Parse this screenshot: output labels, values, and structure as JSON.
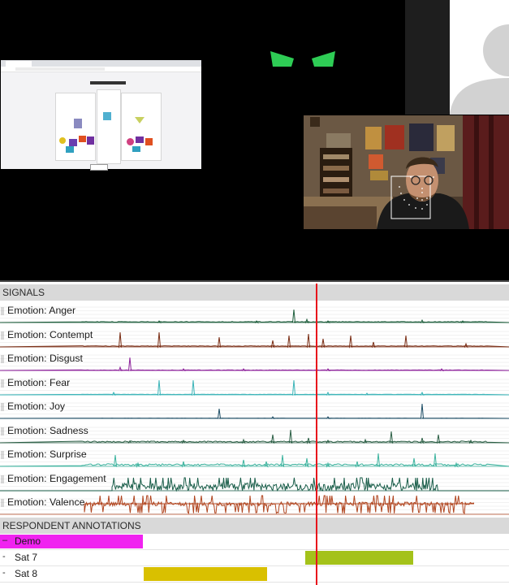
{
  "video": {
    "background": "#000000",
    "eyes_color": "#2ecc55",
    "avatar_icon": "person-silhouette-icon",
    "webcam_subject": "webcam-participant-feed",
    "screen_share": "shared-browser-window"
  },
  "signals_section": {
    "title": "SIGNALS",
    "signals": [
      {
        "label": "Emotion: Anger",
        "color": "#1e5e3c"
      },
      {
        "label": "Emotion: Contempt",
        "color": "#7a2d14"
      },
      {
        "label": "Emotion: Disgust",
        "color": "#8c1f9a"
      },
      {
        "label": "Emotion: Fear",
        "color": "#3ab4b8"
      },
      {
        "label": "Emotion: Joy",
        "color": "#1e4e66"
      },
      {
        "label": "Emotion: Sadness",
        "color": "#2a5e44"
      },
      {
        "label": "Emotion: Surprise",
        "color": "#3bb39e"
      },
      {
        "label": "Emotion: Engagement",
        "color": "#1a5e4a"
      },
      {
        "label": "Emotion: Valence",
        "color": "#b0441e"
      }
    ]
  },
  "annotations_section": {
    "title": "RESPONDENT ANNOTATIONS",
    "rows": [
      {
        "bullet": "–",
        "label": "Demo",
        "color": "#f022f0"
      },
      {
        "bullet": "-",
        "label": "Sat 7",
        "color": "#a4c21a"
      },
      {
        "bullet": "-",
        "label": "Sat 8",
        "color": "#d9c000"
      }
    ]
  },
  "timeline": {
    "cursor_color": "#e8141c"
  }
}
